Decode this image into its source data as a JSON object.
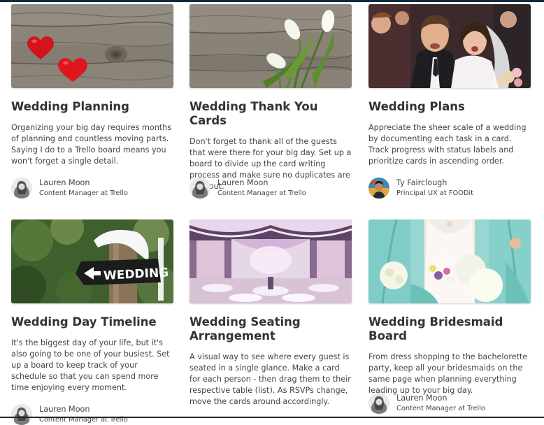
{
  "templates": [
    {
      "title": "Wedding Planning",
      "description": "Organizing your big day requires months of planning and countless moving parts. Saying I do to a Trello board means you won't forget a single detail.",
      "author": {
        "name": "Lauren Moon",
        "role": "Content Manager at Trello"
      },
      "image_icon": "hearts-on-wood-icon"
    },
    {
      "title": "Wedding Thank You Cards",
      "description": "Don't forget to thank all of the guests that were there for your big day. Set up a board to divide up the card writing process and make sure no duplicates are sent out.",
      "author": {
        "name": "Lauren Moon",
        "role": "Content Manager at Trello"
      },
      "image_icon": "tulips-on-wood-icon"
    },
    {
      "title": "Wedding Plans",
      "description": "Appreciate the sheer scale of a wedding by documenting each task in a card. Track progress with status labels and prioritize cards in ascending order.",
      "author": {
        "name": "Ty Fairclough",
        "role": "Principal UX at FOODit"
      },
      "image_icon": "wedding-couple-photo-icon"
    },
    {
      "title": "Wedding Day Timeline",
      "description": "It's the biggest day of your life, but it's also going to be one of your busiest. Set up a board to keep track of your schedule so that you can spend more time enjoying every moment.",
      "author": {
        "name": "Lauren Moon",
        "role": "Content Manager at Trello"
      },
      "image_icon": "wedding-sign-icon",
      "sign_text": "WEDDING"
    },
    {
      "title": "Wedding Seating Arrangement",
      "description": "A visual way to see where every guest is seated in a single glance. Make a card for each person - then drag them to their respective table (list). As RSVPs change, move the cards around accordingly.",
      "author": {
        "name": "Lauren Moon",
        "role": "Content Manager at Trello"
      },
      "image_icon": "reception-hall-icon"
    },
    {
      "title": "Wedding Bridesmaid Board",
      "description": "From dress shopping to the bachelorette party, keep all your bridesmaids on the same page when planning everything leading up to your big day.",
      "author": {
        "name": "Lauren Moon",
        "role": "Content Manager at Trello"
      },
      "image_icon": "bridesmaids-bouquet-icon"
    }
  ]
}
